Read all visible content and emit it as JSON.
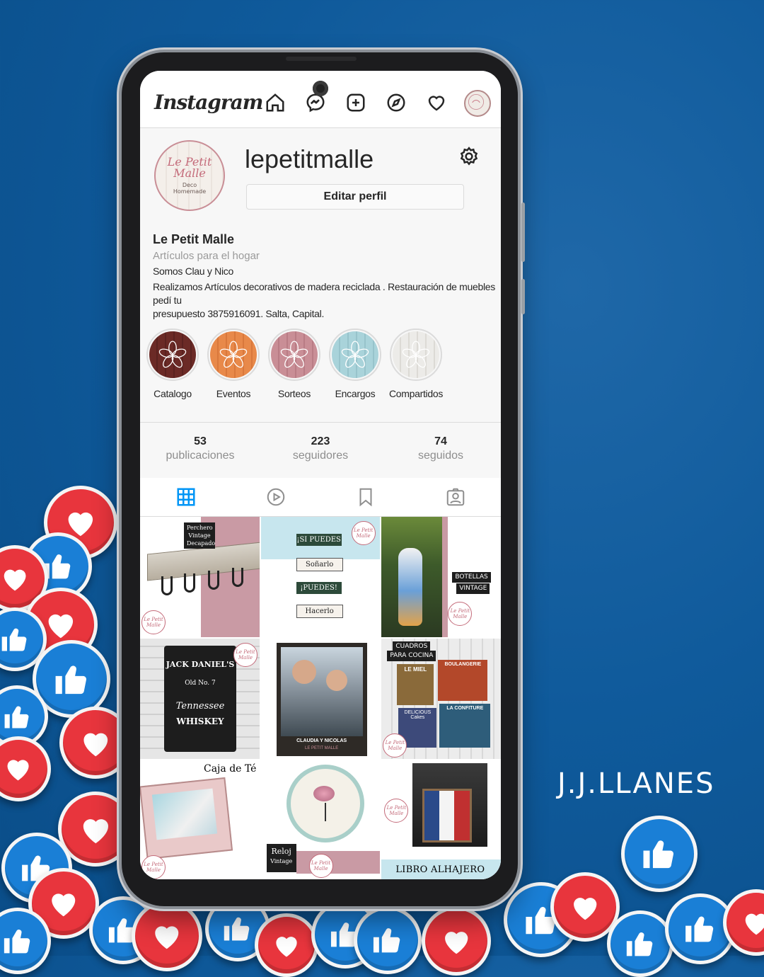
{
  "brand": "J.J.LLANES",
  "app": {
    "logo": "Instagram",
    "header_icons": [
      "home-icon",
      "messenger-icon",
      "new-post-icon",
      "explore-icon",
      "activity-heart-icon",
      "profile-avatar-icon"
    ]
  },
  "profile": {
    "avatar_text_main": "Le Petit Malle",
    "avatar_text_sub": "Deco Homemade",
    "username": "lepetitmalle",
    "edit_button": "Editar perfil",
    "display_name": "Le Petit Malle",
    "category": "Artículos para el hogar",
    "bio_line1": "Somos Clau y Nico",
    "bio_line2": "Realizamos Artículos decorativos de madera reciclada . Restauración de muebles pedí tu",
    "bio_line3": "presupuesto 3875916091. Salta, Capital."
  },
  "highlights": [
    {
      "label": "Catalogo",
      "color": "#6b2a26"
    },
    {
      "label": "Eventos",
      "color": "#e8894a"
    },
    {
      "label": "Sorteos",
      "color": "#c98e96"
    },
    {
      "label": "Encargos",
      "color": "#a9d3da"
    },
    {
      "label": "Compartidos",
      "color": "#e9e6e1"
    }
  ],
  "stats": {
    "posts_count": "53",
    "posts_label": "publicaciones",
    "followers_count": "223",
    "followers_label": "seguidores",
    "following_count": "74",
    "following_label": "seguidos"
  },
  "tabs": [
    "grid-icon",
    "reels-icon",
    "saved-icon",
    "tagged-icon"
  ],
  "posts": {
    "p1_caption": "Perchero Vintage Decapado",
    "p2_sign1": "¡SI PUEDES",
    "p2_sign2": "Soñarlo",
    "p2_sign3": "¡PUEDES!",
    "p2_sign4": "Hacerlo",
    "p3_caption1": "BOTELLAS",
    "p3_caption2": "VINTAGE",
    "p4_label1": "JACK DANIEL'S",
    "p4_label2": "Old No. 7",
    "p4_label3": "Tennessee",
    "p4_label4": "WHISKEY",
    "p5_caption1": "CLAUDIA Y NICOLAS",
    "p5_caption2": "LE PETIT MALLE",
    "p6_caption1": "CUADROS",
    "p6_caption2": "PARA COCINA",
    "p6_card1": "LE MIEL",
    "p6_card2": "BOULANGERIE",
    "p6_card3": "DELICIOUS Cakes",
    "p6_card4": "LA CONFITURE",
    "p7_caption": "Caja de Té",
    "p8_caption1": "Reloj",
    "p8_caption2": "Vintage",
    "p9_caption": "LIBRO ALHAJERO",
    "seal_text": "Le Petit Malle"
  },
  "colors": {
    "background": "#0f5a9b",
    "heart_badge": "#e8353d",
    "like_badge": "#1a7fd6",
    "accent_blue": "#0095f6"
  }
}
